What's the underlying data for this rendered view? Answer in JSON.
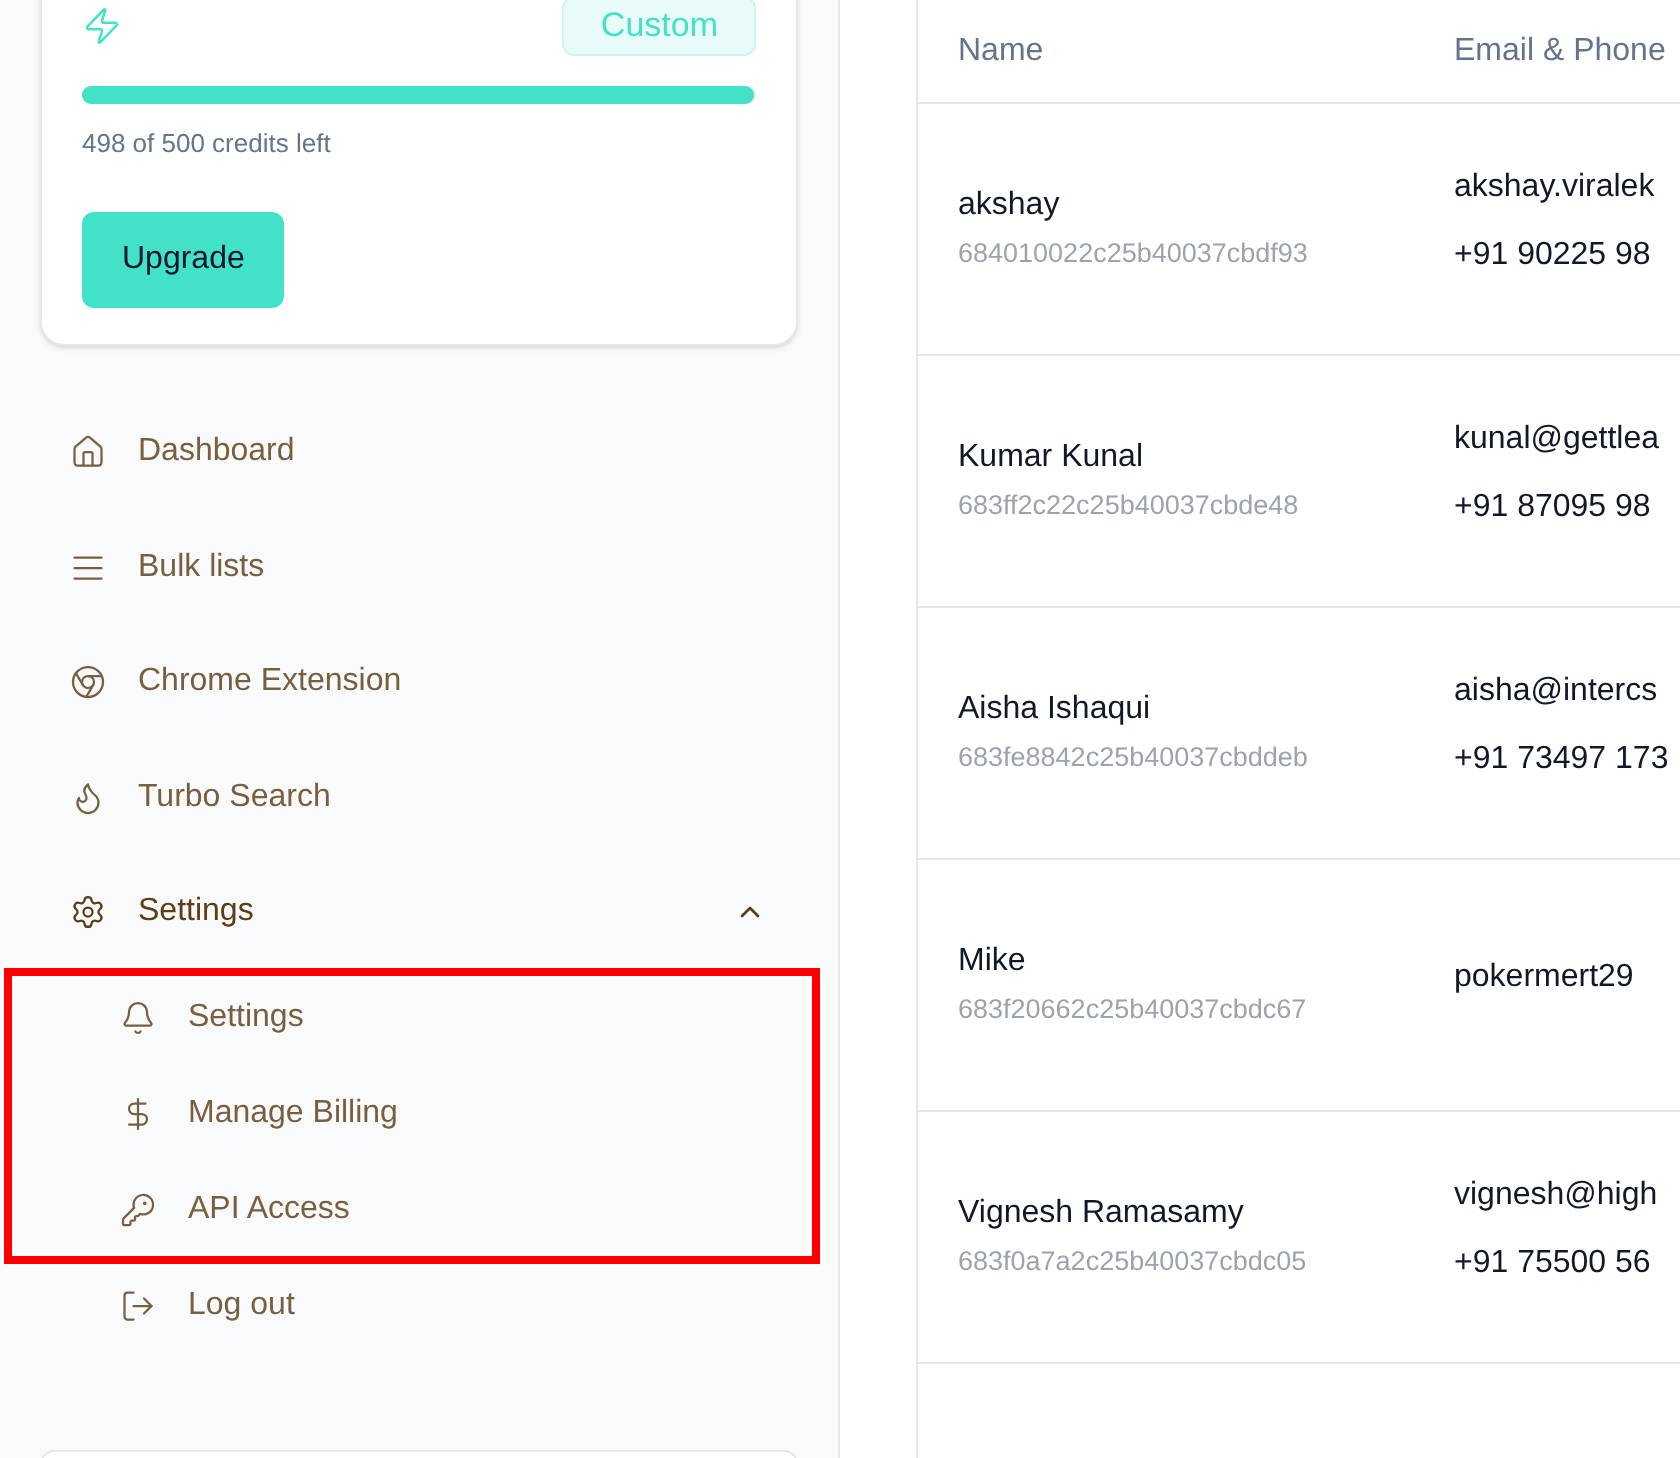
{
  "plan_card": {
    "badge": "Custom",
    "level": 0.996,
    "credits_text": "498 of 500 credits left",
    "upgrade_button": "Upgrade"
  },
  "sidebar": {
    "items": [
      {
        "kind": "home",
        "label": "Dashboard"
      },
      {
        "kind": "list",
        "label": "Bulk lists"
      },
      {
        "kind": "chrome",
        "label": "Chrome Extension"
      },
      {
        "kind": "flame",
        "label": "Turbo Search"
      },
      {
        "kind": "gear",
        "label": "Settings",
        "expanded": true,
        "children": [
          {
            "kind": "bell",
            "label": "Settings"
          },
          {
            "kind": "dollar",
            "label": "Manage Billing"
          },
          {
            "kind": "key",
            "label": "API Access"
          },
          {
            "kind": "logout",
            "label": "Log out"
          }
        ]
      }
    ]
  },
  "table": {
    "columns": [
      "Name",
      "Email & Phone"
    ],
    "rows": [
      {
        "name": "akshay",
        "id": "684010022c25b40037cbdf93",
        "email": "akshay.viralek",
        "phone": "+91 90225 98"
      },
      {
        "name": "Kumar Kunal",
        "id": "683ff2c22c25b40037cbde48",
        "email": "kunal@gettlea",
        "phone": "+91 87095 98"
      },
      {
        "name": "Aisha Ishaqui",
        "id": "683fe8842c25b40037cbddeb",
        "email": "aisha@intercs",
        "phone": "+91 73497 173"
      },
      {
        "name": "Mike",
        "id": "683f20662c25b40037cbdc67",
        "email": "pokermert29"
      },
      {
        "name": "Vignesh Ramasamy",
        "id": "683f0a7a2c25b40037cbdc05",
        "email": "vignesh@high",
        "phone": "+91 75500 56"
      }
    ]
  }
}
